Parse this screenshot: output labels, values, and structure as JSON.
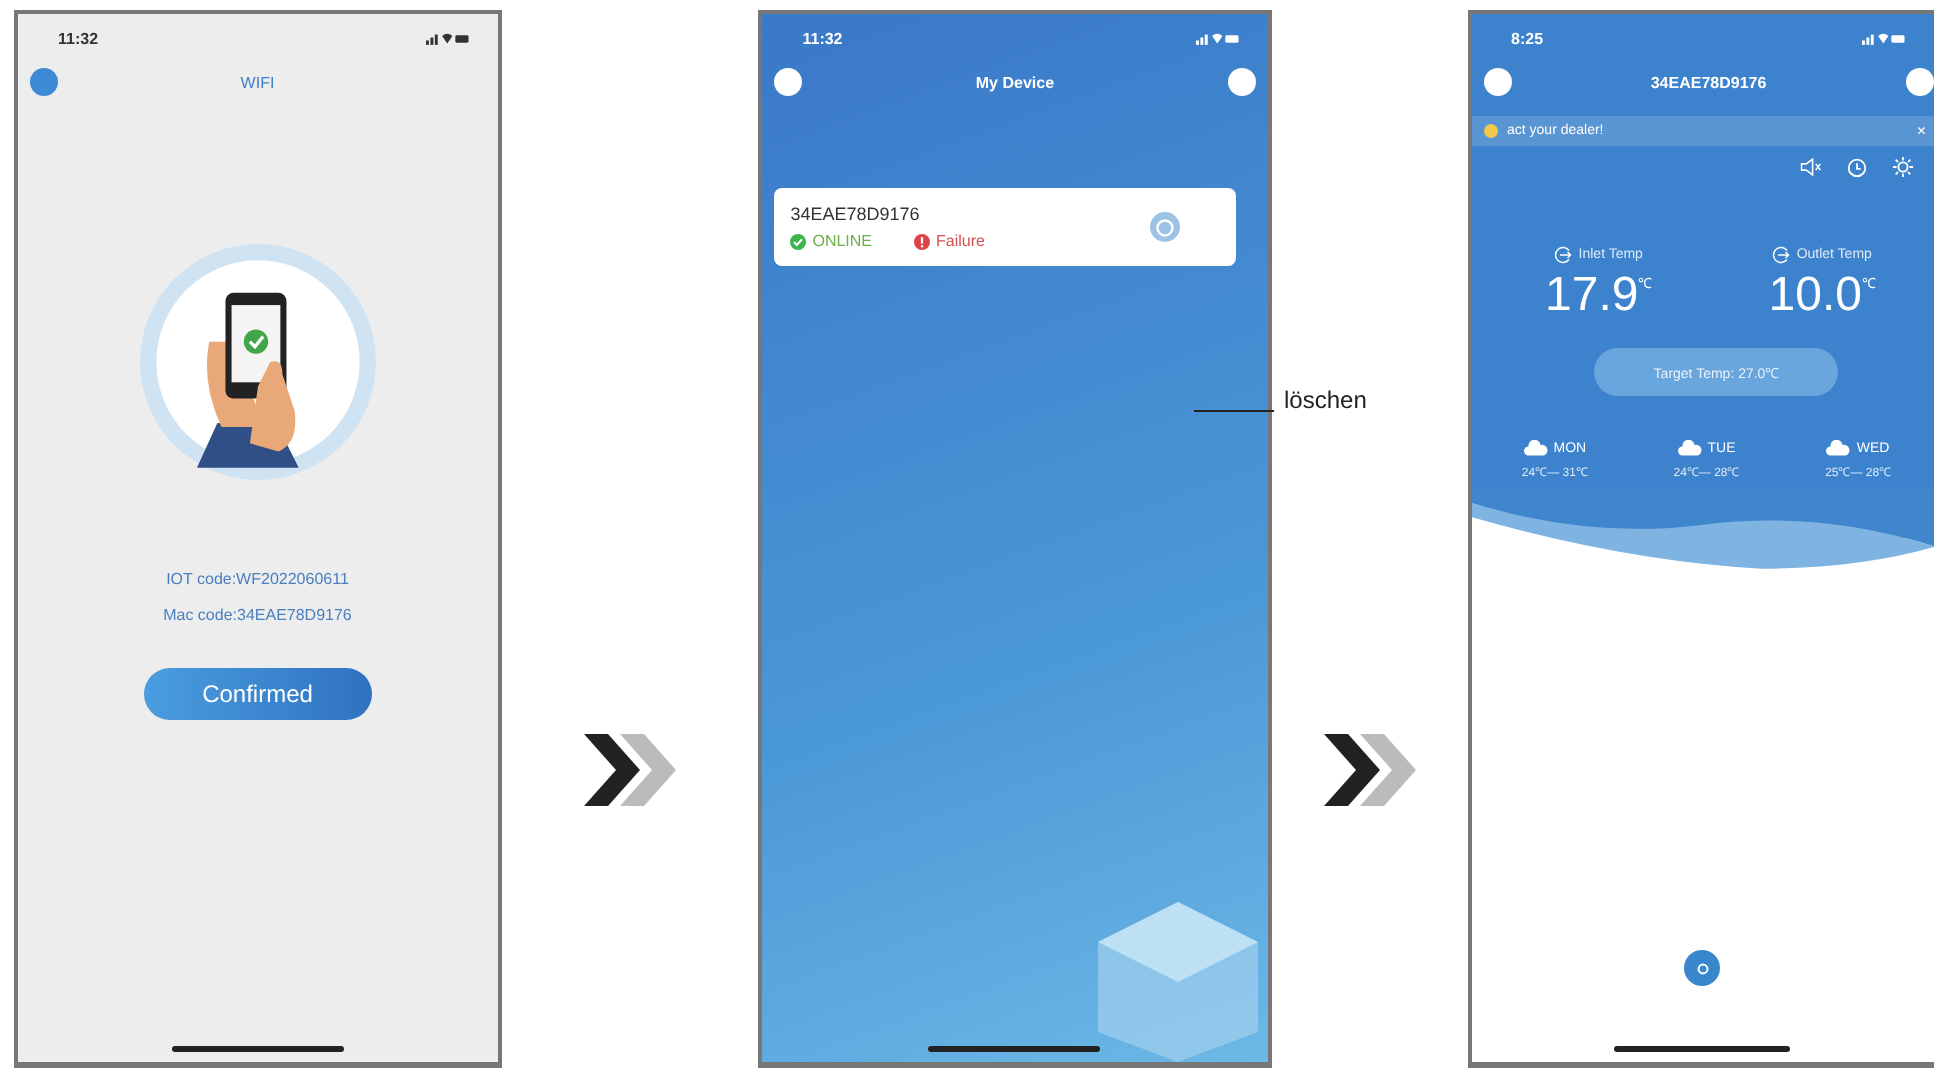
{
  "screens": [
    {
      "kind": "wifi",
      "time": "11:32",
      "title": "WIFI",
      "iot_code": "IOT code:WF2022060611",
      "mac_code": "Mac code:34EAE78D9176",
      "button": "Confirmed"
    },
    {
      "kind": "devices",
      "time": "11:32",
      "title": "My Device",
      "devices": [
        {
          "name": "34EAE78D9176",
          "status": "ONLINE",
          "alarm": "Failure"
        }
      ]
    },
    {
      "kind": "control",
      "time": "8:25",
      "title": "34EAE78D9176",
      "banner": "act your dealer!",
      "banner_close": "×",
      "temps": [
        {
          "label": "Inlet Temp",
          "value": "17.9",
          "unit": "℃"
        },
        {
          "label": "Outlet Temp",
          "value": "10.0",
          "unit": "℃"
        }
      ],
      "target": "Target Temp: 27.0℃",
      "forecast": [
        {
          "day": "MON",
          "range": "24℃— 31℃"
        },
        {
          "day": "TUE",
          "range": "24℃— 28℃"
        },
        {
          "day": "WED",
          "range": "25℃— 28℃"
        }
      ]
    }
  ],
  "callout": "löschen"
}
